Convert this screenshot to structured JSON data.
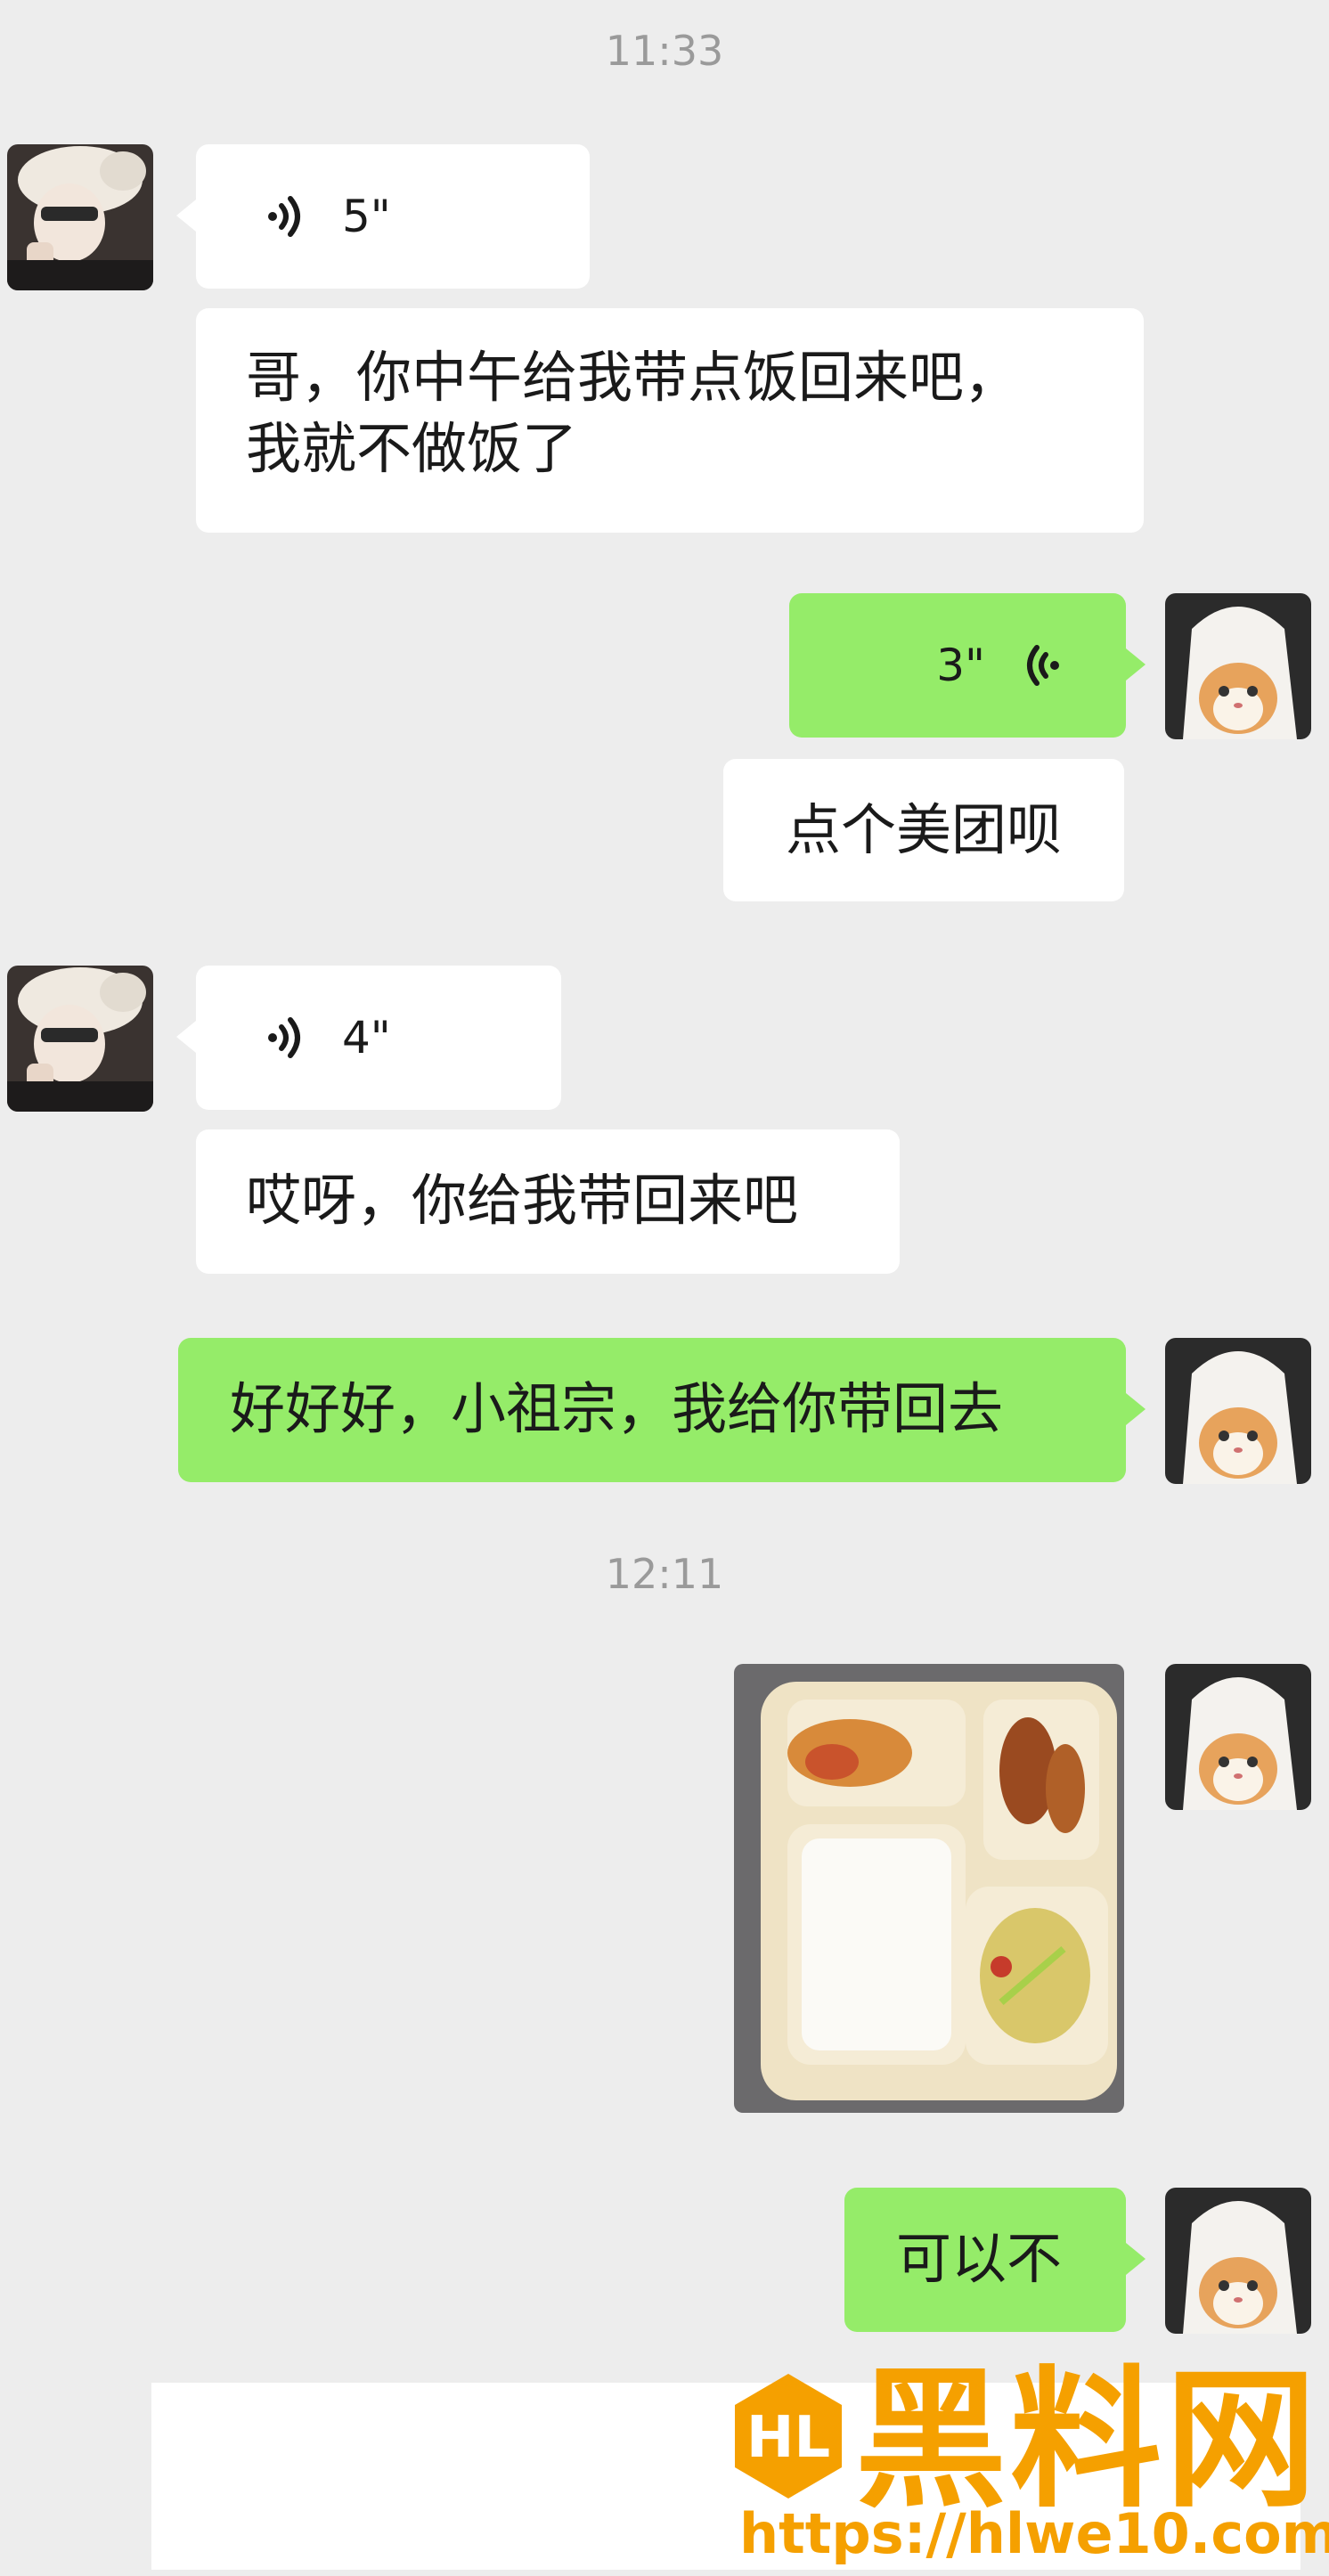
{
  "timestamps": [
    "11:33",
    "12:11"
  ],
  "messages": [
    {
      "side": "in",
      "type": "voice",
      "duration": "5\""
    },
    {
      "side": "in",
      "type": "text",
      "text": "哥，你中午给我带点饭回来吧，\n我就不做饭了"
    },
    {
      "side": "out",
      "type": "voice",
      "duration": "3\""
    },
    {
      "side": "out",
      "type": "text",
      "text": "点个美团呗"
    },
    {
      "side": "in",
      "type": "voice",
      "duration": "4\""
    },
    {
      "side": "in",
      "type": "text",
      "text": "哎呀，你给我带回来吧"
    },
    {
      "side": "out",
      "type": "text",
      "text": "好好好，小祖宗，我给你带回去"
    },
    {
      "side": "out",
      "type": "image",
      "description_icon": "food-box-photo"
    },
    {
      "side": "out",
      "type": "text",
      "text": "可以不"
    }
  ],
  "watermark": {
    "title": "黑料网",
    "url": "https://hlwe10.com"
  },
  "colors": {
    "background": "#ededed",
    "incoming_bubble": "#ffffff",
    "outgoing_bubble": "#95ec69",
    "timestamp": "#9a9a9a",
    "watermark": "#f5a000"
  }
}
